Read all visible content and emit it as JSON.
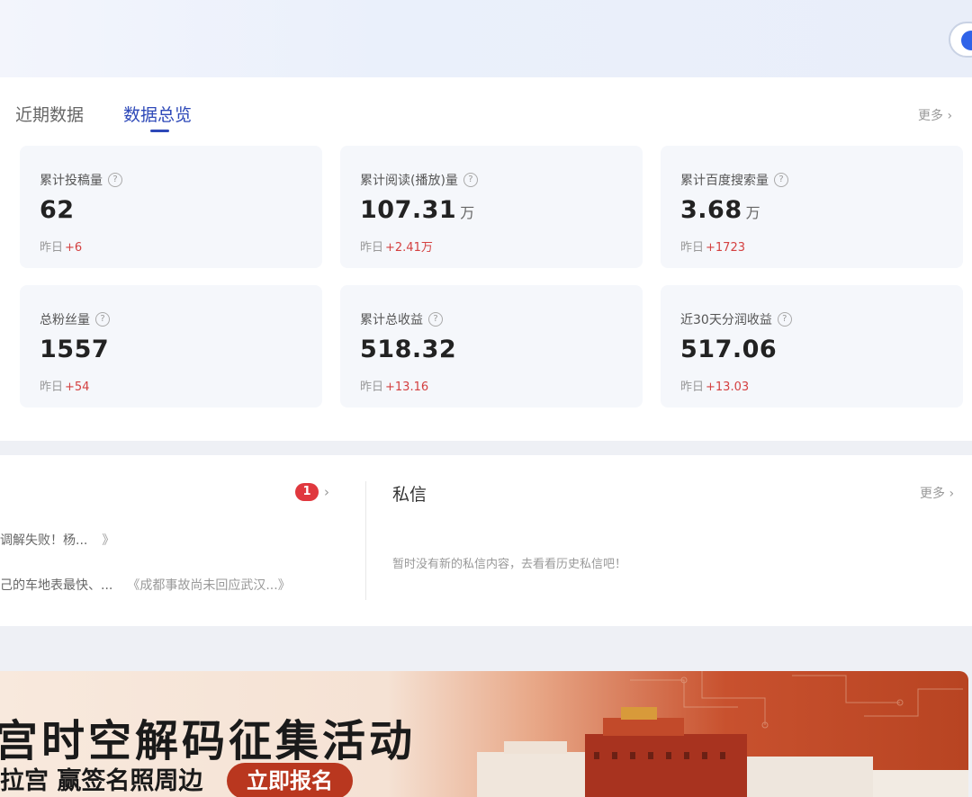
{
  "tabs": [
    {
      "label": "近期数据",
      "active": false
    },
    {
      "label": "数据总览",
      "active": true
    }
  ],
  "more_label": "更多",
  "cards": [
    {
      "label": "累计投稿量",
      "value": "62",
      "unit": "",
      "delta_prefix": "昨日",
      "delta": "+6"
    },
    {
      "label": "累计阅读(播放)量",
      "value": "107.31",
      "unit": "万",
      "delta_prefix": "昨日",
      "delta": "+2.41万"
    },
    {
      "label": "累计百度搜索量",
      "value": "3.68",
      "unit": "万",
      "delta_prefix": "昨日",
      "delta": "+1723"
    },
    {
      "label": "总粉丝量",
      "value": "1557",
      "unit": "",
      "delta_prefix": "昨日",
      "delta": "+54"
    },
    {
      "label": "累计总收益",
      "value": "518.32",
      "unit": "",
      "delta_prefix": "昨日",
      "delta": "+13.16"
    },
    {
      "label": "近30天分润收益",
      "value": "517.06",
      "unit": "",
      "delta_prefix": "昨日",
      "delta": "+13.03"
    }
  ],
  "help_glyph": "?",
  "notifications": {
    "badge_count": "1",
    "items": [
      {
        "text": "调解失败！杨...",
        "quote": "》"
      },
      {
        "text": "己的车地表最快、...",
        "quote": "《成都事故尚未回应武汉...》"
      }
    ]
  },
  "messages": {
    "title": "私信",
    "more_label": "更多",
    "empty_text": "暂时没有新的私信内容，去看看历史私信吧！"
  },
  "promo": {
    "title": "宫时空解码征集活动",
    "subtitle": "拉宫 赢签名照周边",
    "button_label": "立即报名"
  },
  "colors": {
    "accent": "#2d48b8",
    "increase": "#d44040",
    "badge": "#e0383e",
    "promo_button": "#b9371f"
  }
}
